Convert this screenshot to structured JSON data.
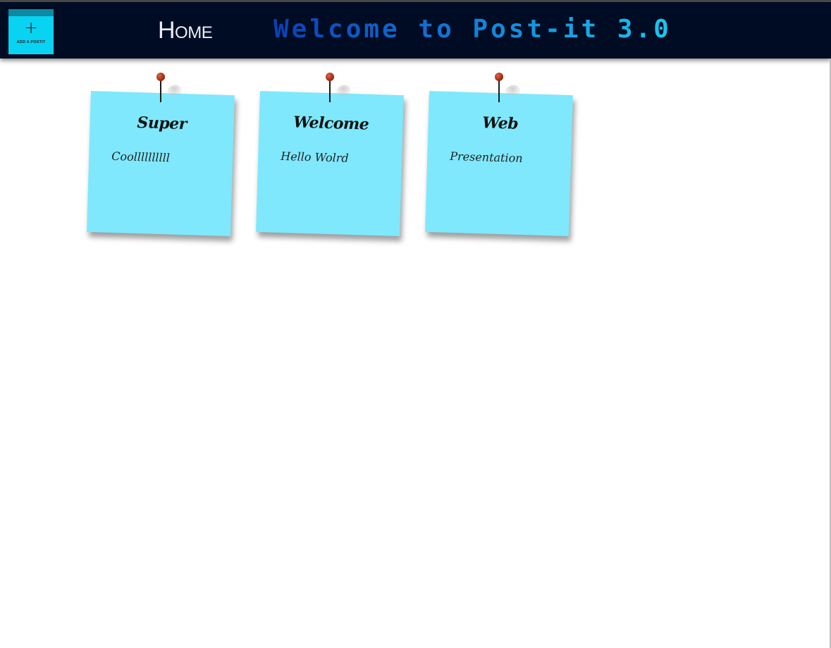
{
  "header": {
    "add_button": {
      "plus": "+",
      "label": "ADD A POSTIT"
    },
    "home_label": "Home",
    "welcome_text": "Welcome to Post-it 3.0"
  },
  "notes": [
    {
      "title": "Super",
      "body": "Coollllllllll"
    },
    {
      "title": "Welcome",
      "body": "Hello Wolrd"
    },
    {
      "title": "Web",
      "body": "Presentation"
    }
  ],
  "colors": {
    "header_bg": "#000c23",
    "add_button_bg": "#08d3f2",
    "note_bg": "#7fe8fc",
    "pin": "#a32a12"
  },
  "icons": {
    "add": "plus-icon",
    "pin": "pushpin-icon"
  }
}
